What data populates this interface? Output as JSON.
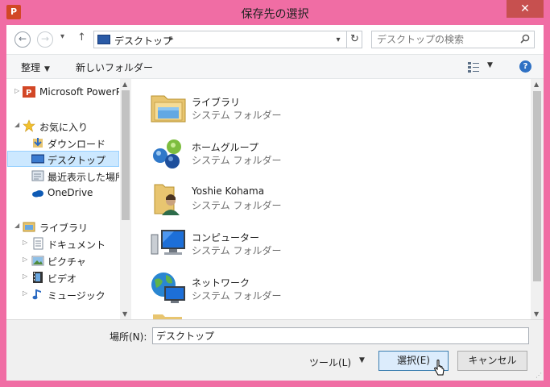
{
  "window": {
    "title": "保存先の選択",
    "app_icon_letter": "P",
    "close_glyph": "✕"
  },
  "address": {
    "path": "デスクトップ",
    "separator": "▸",
    "search_placeholder": "デスクトップの検索"
  },
  "toolbar": {
    "organize": "整理",
    "new_folder": "新しいフォルダー"
  },
  "navpane": {
    "items": [
      {
        "label": "Microsoft PowerP",
        "icon": "powerpoint-icon"
      },
      {
        "label": "お気に入り",
        "icon": "star-icon"
      },
      {
        "label": "ダウンロード",
        "icon": "downloads-icon"
      },
      {
        "label": "デスクトップ",
        "icon": "desktop-icon",
        "selected": true
      },
      {
        "label": "最近表示した場所",
        "icon": "recent-places-icon"
      },
      {
        "label": "OneDrive",
        "icon": "onedrive-icon"
      },
      {
        "label": "ライブラリ",
        "icon": "library-icon"
      },
      {
        "label": "ドキュメント",
        "icon": "documents-icon"
      },
      {
        "label": "ピクチャ",
        "icon": "pictures-icon"
      },
      {
        "label": "ビデオ",
        "icon": "videos-icon"
      },
      {
        "label": "ミュージック",
        "icon": "music-icon"
      }
    ]
  },
  "content": {
    "items": [
      {
        "name": "ライブラリ",
        "desc": "システム フォルダー",
        "icon": "library-folder-icon"
      },
      {
        "name": "ホームグループ",
        "desc": "システム フォルダー",
        "icon": "homegroup-icon"
      },
      {
        "name": "Yoshie Kohama",
        "desc": "システム フォルダー",
        "icon": "user-folder-icon"
      },
      {
        "name": "コンピューター",
        "desc": "システム フォルダー",
        "icon": "computer-icon"
      },
      {
        "name": "ネットワーク",
        "desc": "システム フォルダー",
        "icon": "network-icon"
      }
    ]
  },
  "bottom": {
    "location_label": "場所(N):",
    "location_value": "デスクトップ",
    "tools": "ツール(L)",
    "select_button": "選択(E)",
    "cancel_button": "キャンセル"
  },
  "colors": {
    "frame": "#f06da4",
    "selection": "#cce8ff",
    "accent": "#2f71c4"
  }
}
